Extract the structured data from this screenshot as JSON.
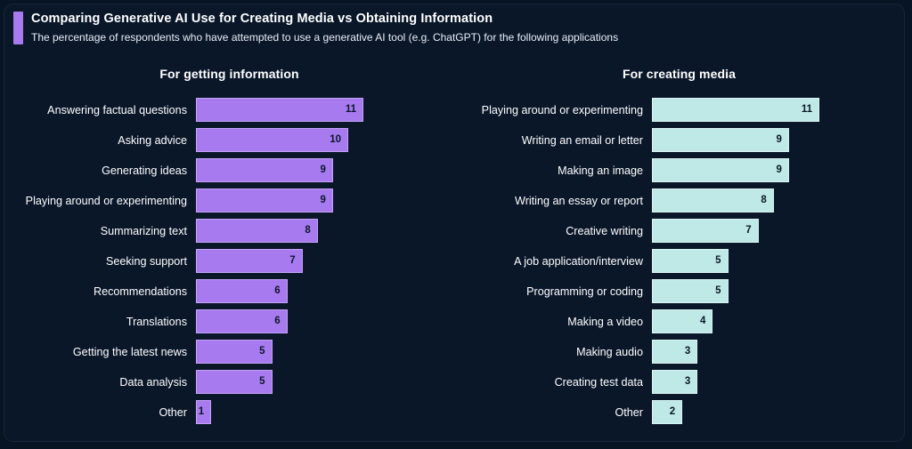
{
  "header": {
    "title": "Comparing Generative AI Use for Creating Media vs Obtaining Information",
    "subtitle": "The percentage of respondents who have attempted to use a generative AI tool (e.g. ChatGPT) for the following applications",
    "accent_color": "#a87af0"
  },
  "theme": {
    "background": "#0a1729",
    "page_background": "#071423",
    "border": "#16263c",
    "text": "#ffffff",
    "value_text": "#0a1729"
  },
  "chart_data": [
    {
      "type": "bar",
      "orientation": "horizontal",
      "title": "For getting information",
      "xlabel": "",
      "ylabel": "",
      "grid": false,
      "legend": "none",
      "bar_color": "#a87af0",
      "bar_border_color": "#c3a3f6",
      "xlim": [
        0,
        11
      ],
      "categories": [
        "Answering factual questions",
        "Asking advice",
        "Generating ideas",
        "Playing around or experimenting",
        "Summarizing text",
        "Seeking support",
        "Recommendations",
        "Translations",
        "Getting the latest news",
        "Data analysis",
        "Other"
      ],
      "values": [
        11,
        10,
        9,
        9,
        8,
        7,
        6,
        6,
        5,
        5,
        1
      ]
    },
    {
      "type": "bar",
      "orientation": "horizontal",
      "title": "For creating media",
      "xlabel": "",
      "ylabel": "",
      "grid": false,
      "legend": "none",
      "bar_color": "#bfe9e6",
      "bar_border_color": "#daf4f2",
      "xlim": [
        0,
        11
      ],
      "categories": [
        "Playing around or experimenting",
        "Writing an email or letter",
        "Making an image",
        "Writing an essay or report",
        "Creative writing",
        "A job application/interview",
        "Programming or coding",
        "Making a video",
        "Making audio",
        "Creating test data",
        "Other"
      ],
      "values": [
        11,
        9,
        9,
        8,
        7,
        5,
        5,
        4,
        3,
        3,
        2
      ]
    }
  ]
}
